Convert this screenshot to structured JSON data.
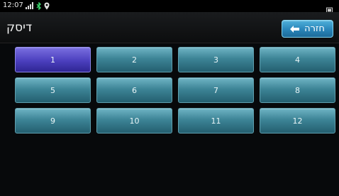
{
  "status": {
    "time": "12:07",
    "icons": [
      "signal-icon",
      "bluetooth-icon",
      "location-icon",
      "battery-icon"
    ]
  },
  "header": {
    "title": "דיסק",
    "back_label": "חזרה"
  },
  "discs": {
    "selected": "1",
    "items": [
      "1",
      "2",
      "3",
      "4",
      "5",
      "6",
      "7",
      "8",
      "9",
      "10",
      "11",
      "12"
    ]
  },
  "colors": {
    "accent": "#2a85b9",
    "button": "#3d8496",
    "selected": "#4b3fbe"
  }
}
